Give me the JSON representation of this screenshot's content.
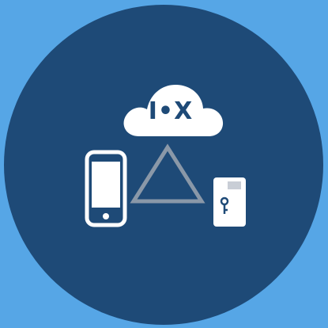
{
  "logo": {
    "text": "I•X"
  },
  "colors": {
    "background": "#56a6e6",
    "circle": "#1e4a77",
    "icon_white": "#ffffff",
    "triangle_gray": "#8a98a8",
    "logo_text": "#1e4a77",
    "key_card_window": "#c9ced6"
  },
  "icons": {
    "cloud": "cloud-icon",
    "smartphone": "smartphone-icon",
    "triangle": "triangle-icon",
    "key_card": "key-card-icon"
  }
}
